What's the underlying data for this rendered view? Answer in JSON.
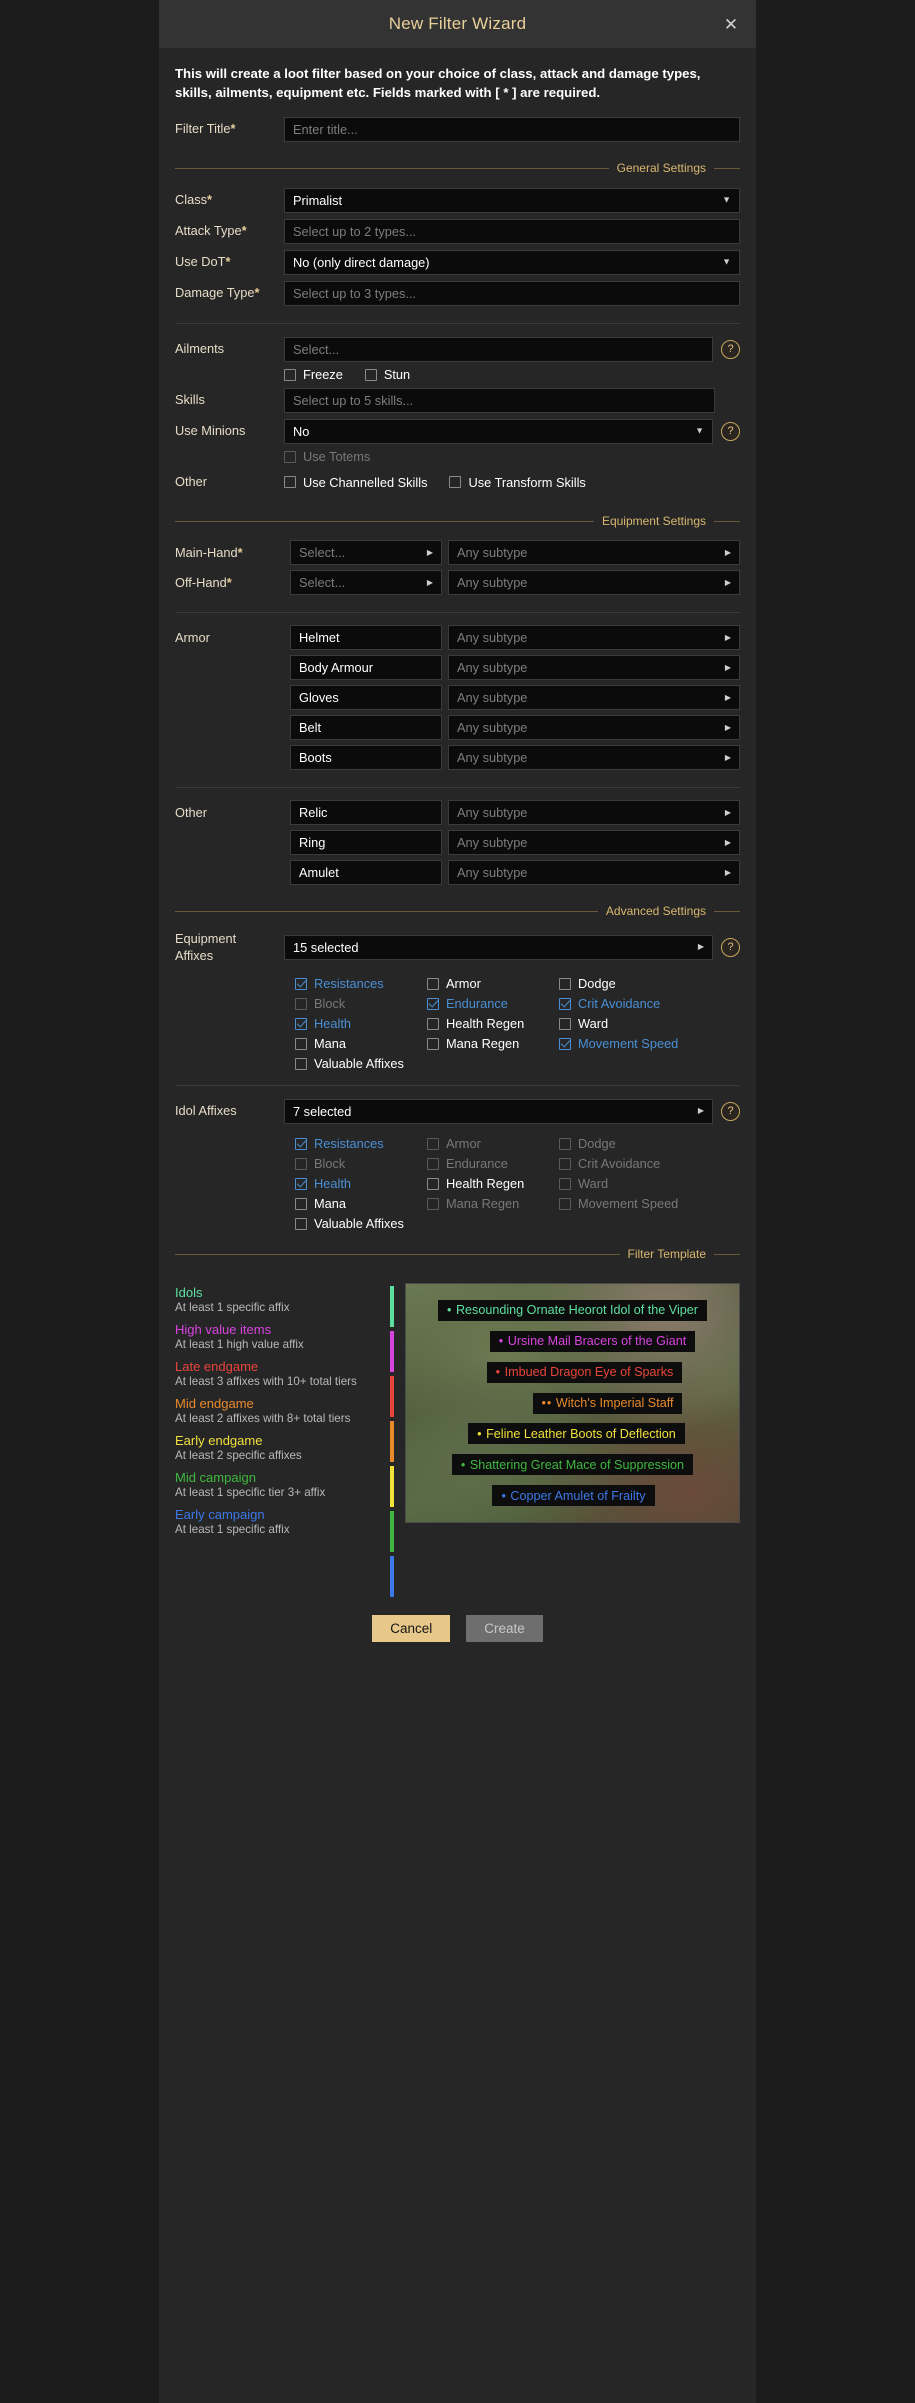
{
  "window": {
    "title": "New Filter Wizard",
    "close_icon": "close-icon"
  },
  "intro": "This will create a loot filter based on your choice of class, attack and damage types, skills, ailments, equipment etc. Fields marked with [ * ] are required.",
  "filter_title": {
    "label": "Filter Title",
    "required": "*",
    "placeholder": "Enter title...",
    "value": ""
  },
  "sections": {
    "general": "General Settings",
    "equipment": "Equipment Settings",
    "advanced": "Advanced Settings",
    "template": "Filter Template"
  },
  "general": {
    "class": {
      "label": "Class",
      "required": "*",
      "value": "Primalist"
    },
    "attack_type": {
      "label": "Attack Type",
      "required": "*",
      "placeholder": "Select up to 2 types..."
    },
    "use_dot": {
      "label": "Use DoT",
      "required": "*",
      "value": "No (only direct damage)"
    },
    "damage_type": {
      "label": "Damage Type",
      "required": "*",
      "placeholder": "Select up to 3 types..."
    },
    "ailments": {
      "label": "Ailments",
      "placeholder": "Select...",
      "help": "?"
    },
    "ailment_checks": [
      {
        "label": "Freeze",
        "checked": false
      },
      {
        "label": "Stun",
        "checked": false
      }
    ],
    "skills": {
      "label": "Skills",
      "placeholder": "Select up to 5 skills..."
    },
    "use_minions": {
      "label": "Use Minions",
      "value": "No",
      "help": "?"
    },
    "use_totems": {
      "label": "Use Totems",
      "checked": false,
      "disabled": true
    },
    "other": {
      "label": "Other"
    },
    "other_checks": [
      {
        "label": "Use Channelled Skills",
        "checked": false
      },
      {
        "label": "Use Transform Skills",
        "checked": false
      }
    ]
  },
  "equipment": {
    "subtype_placeholder": "Any subtype",
    "weapons": [
      {
        "label": "Main-Hand",
        "required": "*",
        "value": "",
        "placeholder": "Select...",
        "subtype": "Any subtype"
      },
      {
        "label": "Off-Hand",
        "required": "*",
        "value": "",
        "placeholder": "Select...",
        "subtype": "Any subtype"
      }
    ],
    "armor_label": "Armor",
    "armor": [
      {
        "value": "Helmet",
        "subtype": "Any subtype"
      },
      {
        "value": "Body Armour",
        "subtype": "Any subtype"
      },
      {
        "value": "Gloves",
        "subtype": "Any subtype"
      },
      {
        "value": "Belt",
        "subtype": "Any subtype"
      },
      {
        "value": "Boots",
        "subtype": "Any subtype"
      }
    ],
    "other_label": "Other",
    "other": [
      {
        "value": "Relic",
        "subtype": "Any subtype"
      },
      {
        "value": "Ring",
        "subtype": "Any subtype"
      },
      {
        "value": "Amulet",
        "subtype": "Any subtype"
      }
    ]
  },
  "equipment_affixes": {
    "label_line1": "Equipment",
    "label_line2": "Affixes",
    "summary": "15 selected",
    "help": "?",
    "items": [
      {
        "label": "Resistances",
        "checked": true,
        "disabled": false
      },
      {
        "label": "Armor",
        "checked": false,
        "disabled": false
      },
      {
        "label": "Dodge",
        "checked": false,
        "disabled": false
      },
      {
        "label": "Block",
        "checked": false,
        "disabled": true
      },
      {
        "label": "Endurance",
        "checked": true,
        "disabled": false
      },
      {
        "label": "Crit Avoidance",
        "checked": true,
        "disabled": false
      },
      {
        "label": "Health",
        "checked": true,
        "disabled": false
      },
      {
        "label": "Health Regen",
        "checked": false,
        "disabled": false
      },
      {
        "label": "Ward",
        "checked": false,
        "disabled": false
      },
      {
        "label": "Mana",
        "checked": false,
        "disabled": false
      },
      {
        "label": "Mana Regen",
        "checked": false,
        "disabled": false
      },
      {
        "label": "Movement Speed",
        "checked": true,
        "disabled": false
      },
      {
        "label": "Valuable Affixes",
        "checked": false,
        "disabled": false
      }
    ]
  },
  "idol_affixes": {
    "label": "Idol Affixes",
    "summary": "7 selected",
    "help": "?",
    "items": [
      {
        "label": "Resistances",
        "checked": true,
        "disabled": false
      },
      {
        "label": "Armor",
        "checked": false,
        "disabled": true
      },
      {
        "label": "Dodge",
        "checked": false,
        "disabled": true
      },
      {
        "label": "Block",
        "checked": false,
        "disabled": true
      },
      {
        "label": "Endurance",
        "checked": false,
        "disabled": true
      },
      {
        "label": "Crit Avoidance",
        "checked": false,
        "disabled": true
      },
      {
        "label": "Health",
        "checked": true,
        "disabled": false
      },
      {
        "label": "Health Regen",
        "checked": false,
        "disabled": false
      },
      {
        "label": "Ward",
        "checked": false,
        "disabled": true
      },
      {
        "label": "Mana",
        "checked": false,
        "disabled": false
      },
      {
        "label": "Mana Regen",
        "checked": false,
        "disabled": true
      },
      {
        "label": "Movement Speed",
        "checked": false,
        "disabled": true
      },
      {
        "label": "Valuable Affixes",
        "checked": false,
        "disabled": false
      }
    ]
  },
  "template": {
    "legend": [
      {
        "title": "Idols",
        "desc": "At least 1 specific affix",
        "color": "#5ce0a0"
      },
      {
        "title": "High value items",
        "desc": "At least 1 high value affix",
        "color": "#d844e0"
      },
      {
        "title": "Late endgame",
        "desc": "At least 3 affixes with 10+ total tiers",
        "color": "#e8453c"
      },
      {
        "title": "Mid endgame",
        "desc": "At least 2 affixes with 8+ total tiers",
        "color": "#e8892c"
      },
      {
        "title": "Early endgame",
        "desc": "At least 2 specific affixes",
        "color": "#f0e03c"
      },
      {
        "title": "Mid campaign",
        "desc": "At least 1 specific tier 3+ affix",
        "color": "#3fb83f"
      },
      {
        "title": "Early campaign",
        "desc": "At least 1 specific affix",
        "color": "#3c78e8"
      }
    ],
    "preview_items": [
      {
        "dots": "•",
        "name": "Resounding Ornate Heorot Idol of the Viper",
        "color": "#5ce0a0"
      },
      {
        "dots": "•",
        "name": "Ursine Mail Bracers of the Giant",
        "color": "#d844e0"
      },
      {
        "dots": "•",
        "name": "Imbued Dragon Eye of Sparks",
        "color": "#e8453c"
      },
      {
        "dots": "••",
        "name": "Witch's Imperial Staff",
        "color": "#e8892c"
      },
      {
        "dots": "•",
        "name": "Feline Leather Boots of Deflection",
        "color": "#f0e03c"
      },
      {
        "dots": "•",
        "name": "Shattering Great Mace of Suppression",
        "color": "#3fb83f"
      },
      {
        "dots": "•",
        "name": "Copper Amulet of Frailty",
        "color": "#3c78e8"
      }
    ]
  },
  "footer": {
    "cancel": "Cancel",
    "create": "Create"
  }
}
